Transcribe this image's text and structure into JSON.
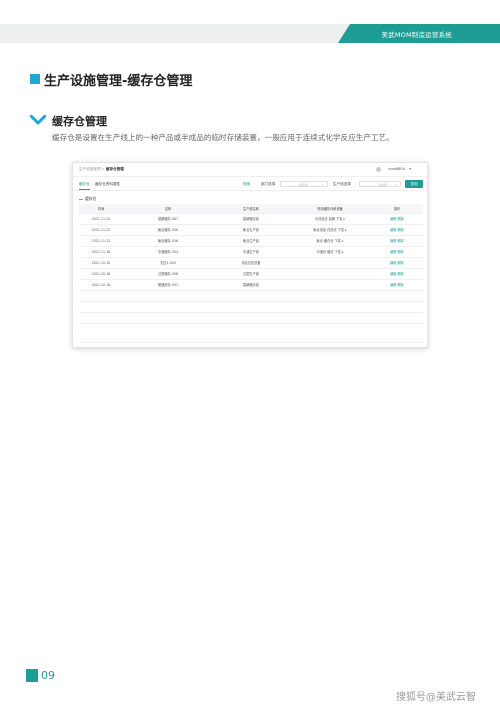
{
  "header": {
    "system_name": "美武MOM制造运营系统"
  },
  "section": {
    "title": "生产设施管理-缓存仓管理",
    "subtitle": "缓存仓管理",
    "description": "缓存仓是设置在生产线上的一种产品或半成品的临时存储装置，一般应用于连续式化学反应生产工艺。"
  },
  "screenshot": {
    "breadcrumb_parent": "生产设施管理",
    "breadcrumb_sep": " > ",
    "breadcrumb_current": "缓存仓管理",
    "user_name": "mxs6804",
    "user_caret": "▾",
    "tabs": [
      "缓存仓",
      "缓存仓资料属性"
    ],
    "search_label": "搜索",
    "filters": [
      {
        "label": "部门选择",
        "placeholder": "请选择"
      },
      {
        "label": "生产线选择",
        "placeholder": "请选择"
      }
    ],
    "query_button": "查询",
    "panel_title": "缓存仓",
    "table": {
      "headers": [
        "时间",
        "名称",
        "生产线名称",
        "所用缓存仓和设备",
        "操作"
      ],
      "rows": [
        [
          "2021-11-22",
          "裂解缓存-087",
          "裂解缓存线",
          "半成品仓 裂解 下发 ▸",
          "编辑 删除"
        ],
        [
          "2021-11-22",
          "聚合缓存-036",
          "聚合生产线",
          "聚合成品 在线仓 下发 ▸",
          "编辑 删除"
        ],
        [
          "2021-11-22",
          "聚合缓存-036",
          "聚合生产线",
          "聚合 缓存仓 下发 ▸",
          "编辑 删除"
        ],
        [
          "2021-11-18",
          "中通缓存-304",
          "中通生产线",
          "中通仓 缓存 下发 ▸",
          "编辑 删除"
        ],
        [
          "2021-10-30",
          "空压1.000",
          "电站空压设备",
          "",
          "编辑 删除"
        ],
        [
          "2021-10-18",
          "注塑缓存-308",
          "注塑生产线",
          "",
          "编辑 删除"
        ],
        [
          "2021-10-18",
          "微通用仓-001",
          "裂解缓存线",
          "",
          "编辑 删除"
        ]
      ]
    }
  },
  "footer": {
    "page_number": "09",
    "watermark": "搜狐号@美武云智"
  }
}
